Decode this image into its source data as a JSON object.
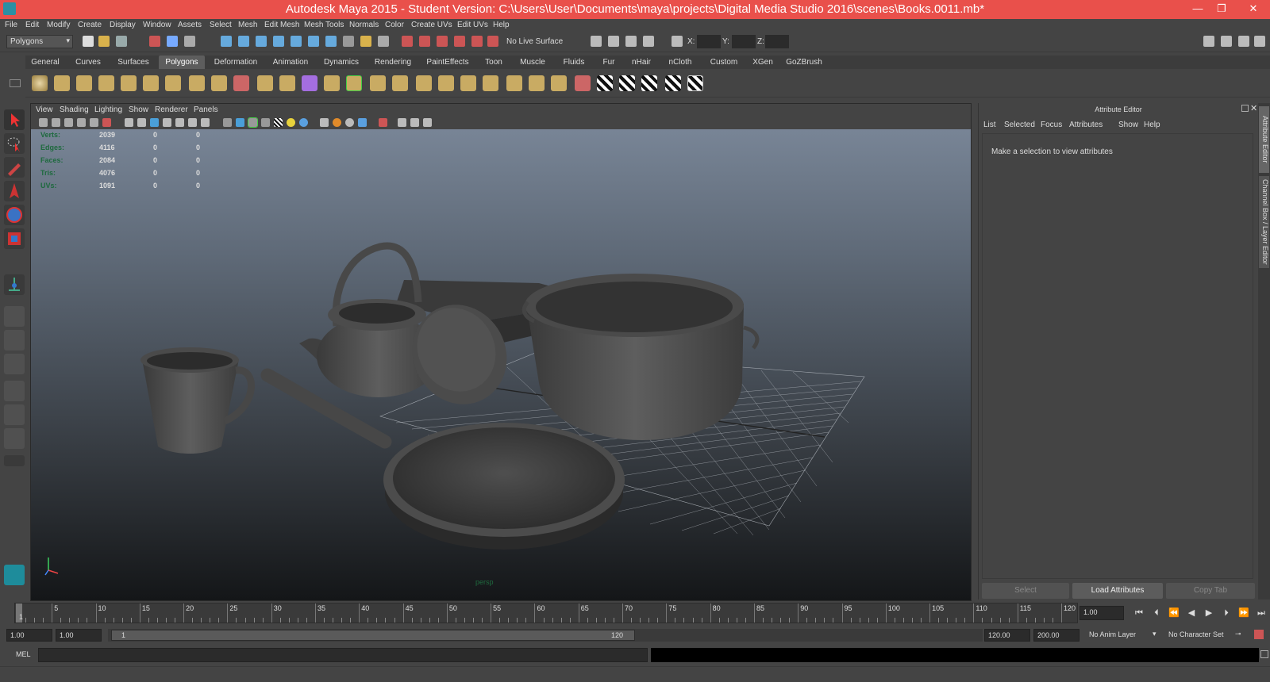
{
  "window": {
    "title": "Autodesk Maya 2015 - Student Version: C:\\Users\\User\\Documents\\maya\\projects\\Digital Media Studio 2016\\scenes\\Books.0011.mb*",
    "minimize": "—",
    "maximize": "❐",
    "close": "✕"
  },
  "menubar": [
    "File",
    "Edit",
    "Modify",
    "Create",
    "Display",
    "Window",
    "Assets",
    "Select",
    "Mesh",
    "Edit Mesh",
    "Mesh Tools",
    "Normals",
    "Color",
    "Create UVs",
    "Edit UVs",
    "Help"
  ],
  "statusline": {
    "menuset": "Polygons",
    "live_surface": "No Live Surface",
    "x_label": "X:",
    "y_label": "Y:",
    "z_label": "Z:"
  },
  "shelf_tabs": [
    "General",
    "Curves",
    "Surfaces",
    "Polygons",
    "Deformation",
    "Animation",
    "Dynamics",
    "Rendering",
    "PaintEffects",
    "Toon",
    "Muscle",
    "Fluids",
    "Fur",
    "nHair",
    "nCloth",
    "Custom",
    "XGen",
    "GoZBrush"
  ],
  "active_shelf_tab": "Polygons",
  "viewport": {
    "menu": [
      "View",
      "Shading",
      "Lighting",
      "Show",
      "Renderer",
      "Panels"
    ],
    "camera_label": "persp",
    "hud": [
      {
        "label": "Verts:",
        "v1": "2039",
        "v2": "0",
        "v3": "0"
      },
      {
        "label": "Edges:",
        "v1": "4116",
        "v2": "0",
        "v3": "0"
      },
      {
        "label": "Faces:",
        "v1": "2084",
        "v2": "0",
        "v3": "0"
      },
      {
        "label": "Tris:",
        "v1": "4076",
        "v2": "0",
        "v3": "0"
      },
      {
        "label": "UVs:",
        "v1": "1091",
        "v2": "0",
        "v3": "0"
      }
    ]
  },
  "attribute_editor": {
    "title": "Attribute Editor",
    "menu": [
      "List",
      "Selected",
      "Focus",
      "Attributes",
      "Show",
      "Help"
    ],
    "message": "Make a selection to view attributes",
    "select_button": "Select",
    "load_button": "Load Attributes",
    "copy_button": "Copy Tab"
  },
  "side_tabs": [
    "Attribute Editor",
    "Channel Box / Layer Editor"
  ],
  "timeline": {
    "ticks": [
      "1",
      "5",
      "10",
      "15",
      "20",
      "25",
      "30",
      "35",
      "40",
      "45",
      "50",
      "55",
      "60",
      "65",
      "70",
      "75",
      "80",
      "85",
      "90",
      "95",
      "100",
      "105",
      "110",
      "115",
      "120"
    ],
    "current_frame": "1.00"
  },
  "range": {
    "start": "1.00",
    "playback_start": "1.00",
    "slider_start": "1",
    "slider_end": "120",
    "playback_end": "120.00",
    "end": "200.00",
    "anim_layer": "No Anim Layer",
    "character_set": "No Character Set"
  },
  "command_line": {
    "label": "MEL"
  }
}
